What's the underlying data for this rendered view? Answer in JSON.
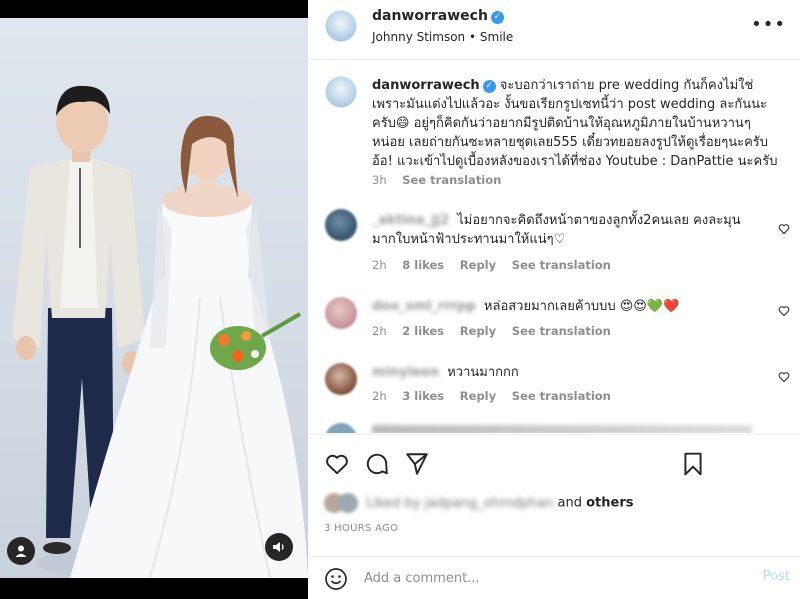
{
  "header": {
    "username": "danworrawech",
    "music_artist": "Johnny Stimson",
    "music_separator": "•",
    "music_track": "Smile"
  },
  "caption": {
    "username": "danworrawech",
    "text": "จะบอกว่าเราถ่าย pre wedding กันก็คงไม่ใช่ เพราะมันแต่งไปแล้วอะ งั้นขอเรียกรูปเซทนี้ว่า post wedding ละกันนะครับ😄 อยู่ๆก็คิดกันว่าอยากมีรูปติดบ้านให้อุณหภูมิภายในบ้านหวานๆหน่อย เลยถ่ายกันซะหลายชุดเลย555 เดี๋ยวทยอยลงรูปให้ดูเรื่อยๆนะครับ อ้อ! แวะเข้าไปดูเบื้องหลังของเราได้ที่ช่อง Youtube : DanPattie นะครับ",
    "time": "3h",
    "see_translation": "See translation"
  },
  "comments": [
    {
      "username": "_aktina_jj2",
      "text": "ไม่อยากจะคิดถึงหน้าตาของลูกทั้ง2คนเลย คงละมุนมากใบหน้าฟ้าประทานมาให้แน่ๆ♡",
      "time": "2h",
      "likes": "8 likes",
      "reply": "Reply",
      "see_translation": "See translation"
    },
    {
      "username": "doo_sml_rrrpp",
      "text": "หล่อสวยมากเลยค้าบบบ 😍😍💚❤️",
      "time": "2h",
      "likes": "2 likes",
      "reply": "Reply",
      "see_translation": "See translation"
    },
    {
      "username": "minyleen",
      "text": "หวานมากกก",
      "time": "2h",
      "likes": "3 likes",
      "reply": "Reply",
      "see_translation": "See translation"
    }
  ],
  "likes_summary": {
    "liked_by_blurred": "Liked by jadpang_ohmdphan",
    "and": "and",
    "others": "others"
  },
  "timestamp": "3 HOURS AGO",
  "add_comment": {
    "placeholder": "Add a comment...",
    "post_label": "Post"
  },
  "colors": {
    "verified": "#3897f0",
    "post_disabled": "#b2dffc",
    "heart_red": "#ed4956",
    "heart_green": "#3ccf4e"
  },
  "icons": {
    "more": "more-horizontal-icon",
    "like": "heart-icon",
    "comment": "comment-bubble-icon",
    "share": "paper-plane-icon",
    "save": "bookmark-icon",
    "emoji": "smiley-icon",
    "user_tag": "user-tag-icon",
    "audio": "speaker-icon"
  }
}
